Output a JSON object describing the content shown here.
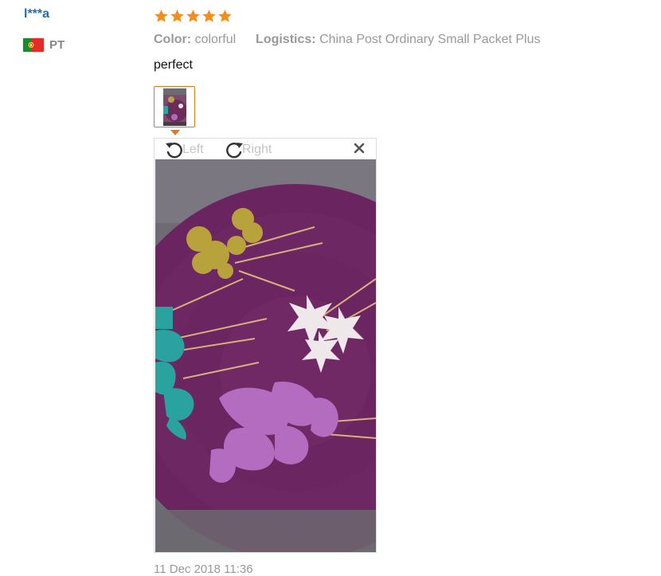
{
  "reviewer": {
    "name": "l***a",
    "country_code": "PT",
    "flag_icon": "portugal-flag-icon"
  },
  "rating": {
    "value": 5,
    "max": 5,
    "star_color": "#f48d1b"
  },
  "attributes": [
    {
      "label": "Color:",
      "value": "colorful"
    },
    {
      "label": "Logistics:",
      "value": "China Post Ordinary Small Packet Plus"
    }
  ],
  "review": {
    "text": "perfect",
    "date": "11 Dec 2018 11:36"
  },
  "image_viewer": {
    "rotate_left_label": "Left",
    "rotate_right_label": "Right",
    "rotate_left_icon": "rotate-left-icon",
    "rotate_right_icon": "rotate-right-icon",
    "close_icon": "close-icon",
    "photo": "review-photo"
  },
  "colors": {
    "username": "#1f6fb5",
    "accent_border": "#e47911",
    "muted_text": "#999999"
  }
}
